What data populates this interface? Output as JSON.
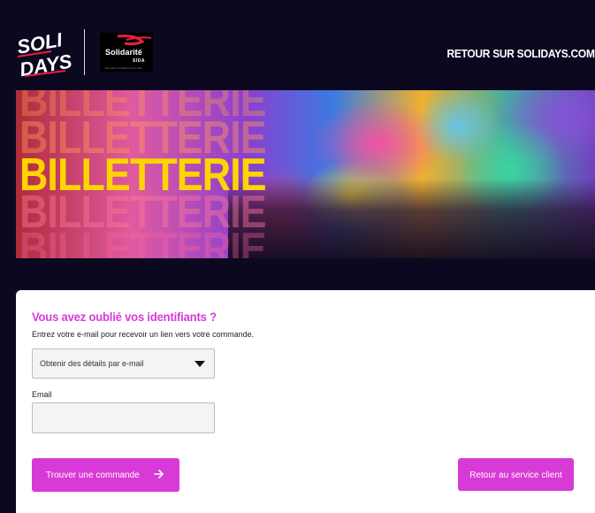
{
  "header": {
    "logo_text": "SOLI DAYS",
    "partner_logo": {
      "name": "Solidarité",
      "sub": "SIDA",
      "tagline": "Pas assez solidaires qu'un sida"
    },
    "back_link": "RETOUR SUR SOLIDAYS.COM"
  },
  "banner": {
    "words": [
      "BILLETTERIE",
      "BILLETTERIE",
      "BILLETTERIE",
      "BILLETTERIE",
      "BILLETTERIE"
    ]
  },
  "form": {
    "title": "Vous avez oublié vos identifiants ?",
    "subtitle": "Entrez votre e-mail pour recevoir un lien vers votre commande.",
    "method_select": {
      "value": "Obtenir des détails par e-mail"
    },
    "email": {
      "label": "Email",
      "value": "",
      "placeholder": ""
    },
    "submit_label": "Trouver une commande",
    "service_label": "Retour au service client"
  },
  "colors": {
    "accent": "#d83ad6",
    "background": "#0c0820",
    "highlight": "#ffd400"
  }
}
